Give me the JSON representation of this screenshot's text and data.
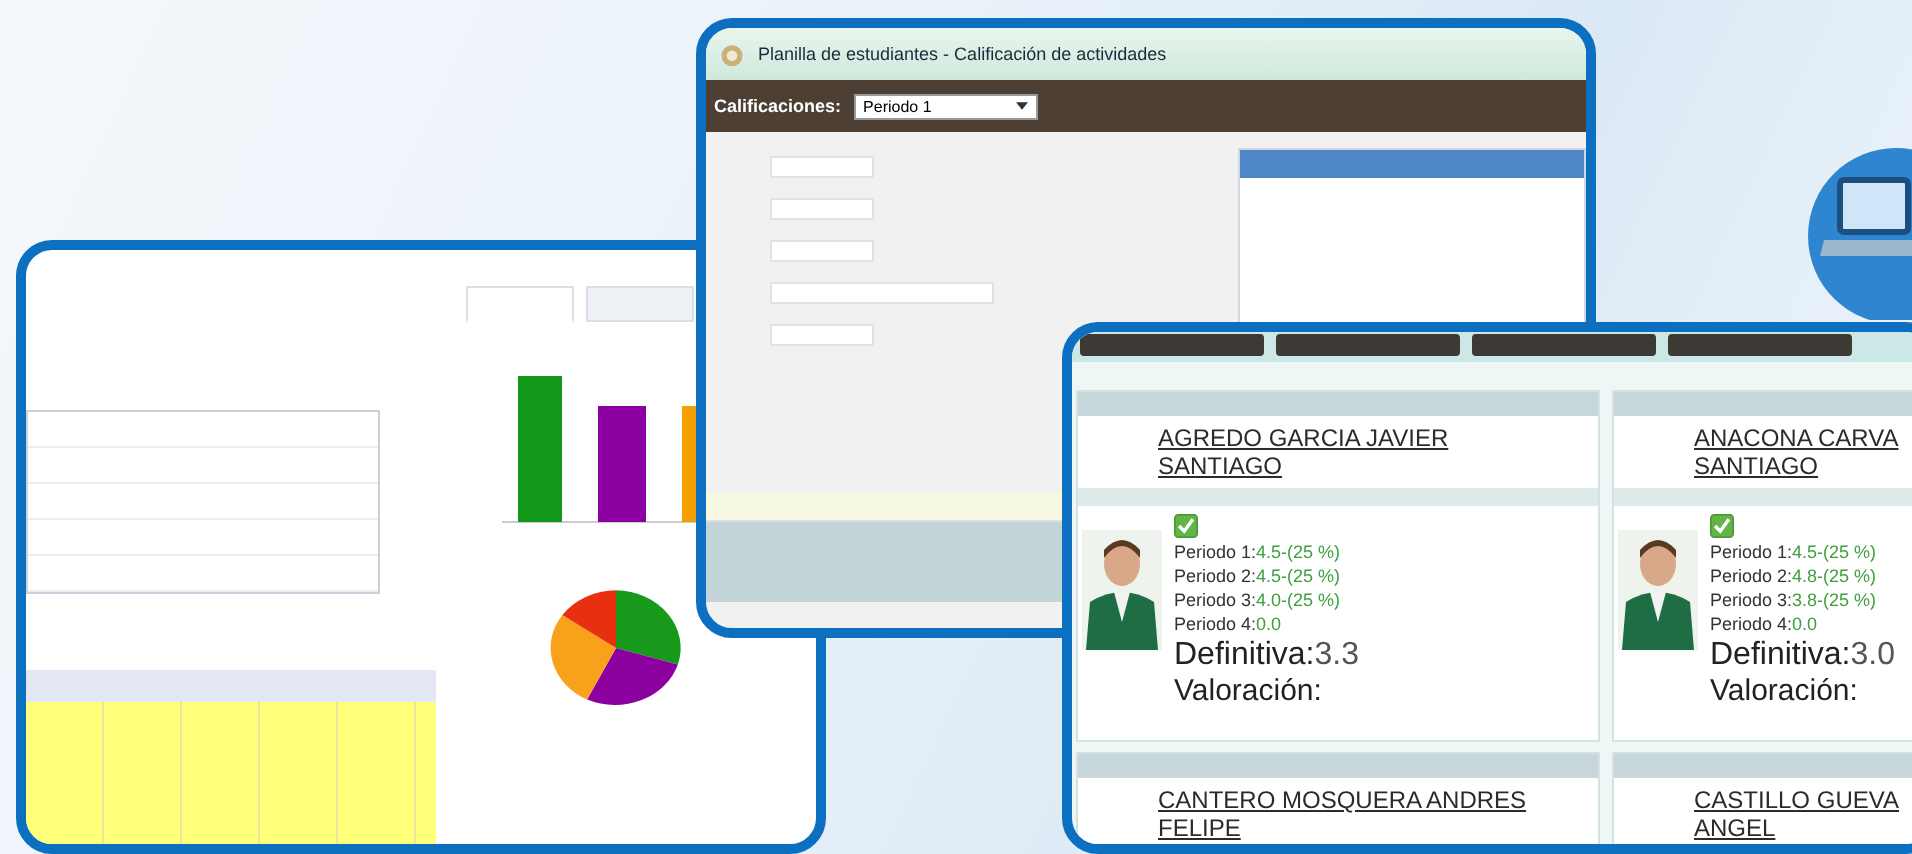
{
  "grades_window": {
    "title": "Planilla de estudiantes - Calificación de actividades",
    "toolbar_label": "Calificaciones:",
    "period_select": "Periodo 1"
  },
  "students": [
    {
      "name_lines": [
        "AGREDO GARCIA JAVIER",
        "SANTIAGO"
      ],
      "checked": true,
      "periods": [
        {
          "label": "Periodo 1:",
          "value": "4.5-(25 %)"
        },
        {
          "label": "Periodo 2:",
          "value": "4.5-(25 %)"
        },
        {
          "label": "Periodo 3:",
          "value": "4.0-(25 %)"
        },
        {
          "label": "Periodo 4:",
          "value": "0.0"
        }
      ],
      "final_label": "Definitiva:",
      "final": "3.3",
      "rating_label": "Valoración:"
    },
    {
      "name_lines": [
        "ANACONA CARVA",
        "SANTIAGO"
      ],
      "checked": true,
      "periods": [
        {
          "label": "Periodo 1:",
          "value": "4.5-(25 %)"
        },
        {
          "label": "Periodo 2:",
          "value": "4.8-(25 %)"
        },
        {
          "label": "Periodo 3:",
          "value": "3.8-(25 %)"
        },
        {
          "label": "Periodo 4:",
          "value": "0.0"
        }
      ],
      "final_label": "Definitiva:",
      "final": "3.0",
      "rating_label": "Valoración:"
    }
  ],
  "more_students": [
    {
      "name_lines": [
        "CANTERO MOSQUERA ANDRES",
        "FELIPE"
      ]
    },
    {
      "name_lines": [
        "CASTILLO GUEVA",
        "ANGEL"
      ]
    }
  ]
}
